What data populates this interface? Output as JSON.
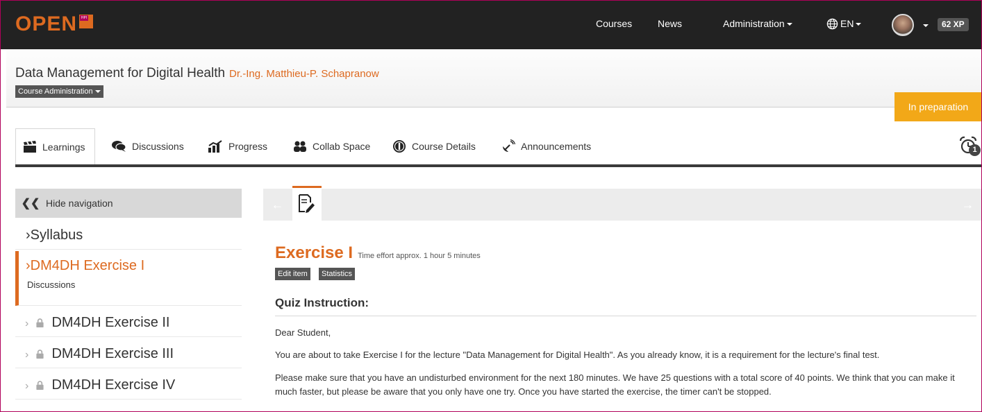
{
  "brand": {
    "logo_text": "OPEN",
    "logo_badge": "HPI",
    "accent": "#dd6a20"
  },
  "topnav": {
    "courses": "Courses",
    "news": "News",
    "administration": "Administration",
    "language": "EN",
    "xp": "62 XP"
  },
  "course": {
    "title": "Data Management for Digital Health",
    "teacher": "Dr.-Ing. Matthieu-P. Schapranow",
    "admin_menu": "Course Administration",
    "status": "In preparation",
    "status_color": "#f2a818"
  },
  "tabs": [
    {
      "label": "Learnings",
      "icon": "clapperboard-icon",
      "active": true
    },
    {
      "label": "Discussions",
      "icon": "chat-bubble-icon"
    },
    {
      "label": "Progress",
      "icon": "chart-icon"
    },
    {
      "label": "Collab Space",
      "icon": "users-icon"
    },
    {
      "label": "Course Details",
      "icon": "info-icon"
    },
    {
      "label": "Announcements",
      "icon": "satellite-icon"
    }
  ],
  "notifications": {
    "icon": "alarm-clock-icon",
    "count": "1"
  },
  "sidebar": {
    "hide_label": "Hide navigation",
    "syllabus": "Syllabus",
    "active_item": {
      "title": "DM4DH Exercise I",
      "sub": "Discussions"
    },
    "locked_items": [
      "DM4DH Exercise II",
      "DM4DH Exercise III",
      "DM4DH Exercise IV"
    ]
  },
  "content": {
    "item_icon": "quiz-edit-icon",
    "exercise_title": "Exercise I",
    "time_effort": "Time effort approx. 1 hour 5 minutes",
    "edit_label": "Edit item",
    "statistics_label": "Statistics",
    "heading": "Quiz Instruction:",
    "greeting": "Dear Student,",
    "paragraph_1": "You are about to take Exercise I for the lecture \"Data Management for Digital Health\". As you already know, it is a requirement for the lecture's final test.",
    "paragraph_2": "Please make sure that you have an undisturbed environment for the next 180 minutes. We have 25 questions with a total score of 40 points. We think that you can make it much faster, but please be aware that you only have one try. Once you have started the exercise, the timer can't be stopped."
  }
}
